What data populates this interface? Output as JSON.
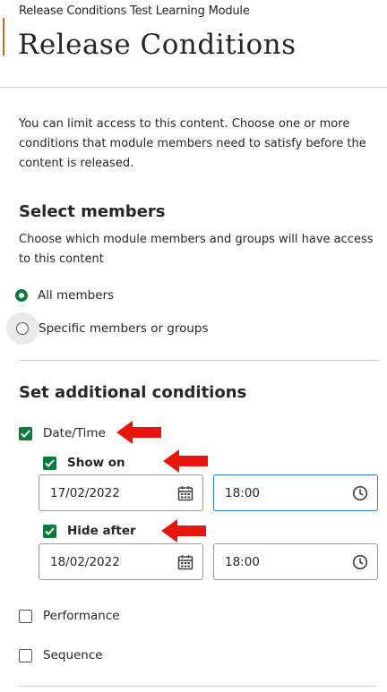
{
  "header": {
    "breadcrumb": "Release Conditions Test Learning Module",
    "title": "Release Conditions"
  },
  "intro": {
    "text": "You can limit access to this content. Choose one or more conditions that module members need to satisfy before the content is released."
  },
  "select_members": {
    "title": "Select members",
    "description": "Choose which module members and groups will have access to this content",
    "options": [
      {
        "label": "All members",
        "selected": true
      },
      {
        "label": "Specific members or groups",
        "selected": false
      }
    ]
  },
  "additional_conditions": {
    "title": "Set additional conditions",
    "date_time": {
      "label": "Date/Time",
      "checked": true,
      "show_on": {
        "label": "Show on",
        "checked": true,
        "date": "17/02/2022",
        "time": "18:00"
      },
      "hide_after": {
        "label": "Hide after",
        "checked": true,
        "date": "18/02/2022",
        "time": "18:00"
      }
    },
    "performance": {
      "label": "Performance",
      "checked": false
    },
    "sequence": {
      "label": "Sequence",
      "checked": false
    }
  },
  "colors": {
    "accent": "#0b7a3b",
    "annotation_arrow": "#e8160c",
    "focus_border": "#2d7bd1",
    "title_accent_bar": "#d2691e"
  },
  "icons": {
    "date_picker": "calendar-icon",
    "time_picker": "clock-icon",
    "annotation": "red-arrow-icon"
  }
}
